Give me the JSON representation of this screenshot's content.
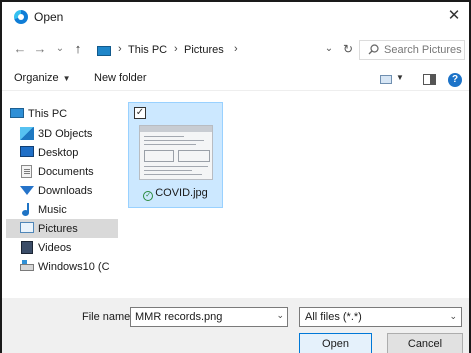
{
  "window": {
    "title": "Open",
    "close_glyph": "✕"
  },
  "nav_buttons": {
    "back": "←",
    "forward": "→",
    "recent": "⌄",
    "up": "↑"
  },
  "address": {
    "crumbs": [
      "This PC",
      "Pictures"
    ],
    "separator": "›",
    "dropdown": "⌄",
    "refresh": "↻"
  },
  "search": {
    "placeholder": "Search Pictures",
    "value": ""
  },
  "toolbar": {
    "organize": "Organize",
    "organize_caret": "▼",
    "new_folder": "New folder",
    "view_caret": "▼",
    "help": "?"
  },
  "nav_pane": {
    "items": [
      {
        "label": "This PC",
        "icon": "pc-icon"
      },
      {
        "label": "3D Objects",
        "icon": "3d-objects-icon"
      },
      {
        "label": "Desktop",
        "icon": "desktop-icon"
      },
      {
        "label": "Documents",
        "icon": "documents-icon"
      },
      {
        "label": "Downloads",
        "icon": "downloads-icon"
      },
      {
        "label": "Music",
        "icon": "music-icon"
      },
      {
        "label": "Pictures",
        "icon": "pictures-icon",
        "selected": true
      },
      {
        "label": "Videos",
        "icon": "videos-icon"
      },
      {
        "label": "Windows10 (C",
        "icon": "drive-icon"
      }
    ]
  },
  "files": [
    {
      "name": "COVID.jpg",
      "checked": true,
      "check_glyph": "✓",
      "sync_glyph": "✓"
    }
  ],
  "bottom": {
    "file_name_label": "File name:",
    "file_name_value": "MMR records.png",
    "file_name_drop": "⌄",
    "file_type": "All files (*.*)",
    "file_type_drop": "⌄",
    "open_label": "Open",
    "cancel_label": "Cancel"
  },
  "colors": {
    "selection": "#cce8ff",
    "selection_border": "#99d1ff",
    "accent": "#0078d7",
    "nav_selected": "#d9d9d9"
  }
}
